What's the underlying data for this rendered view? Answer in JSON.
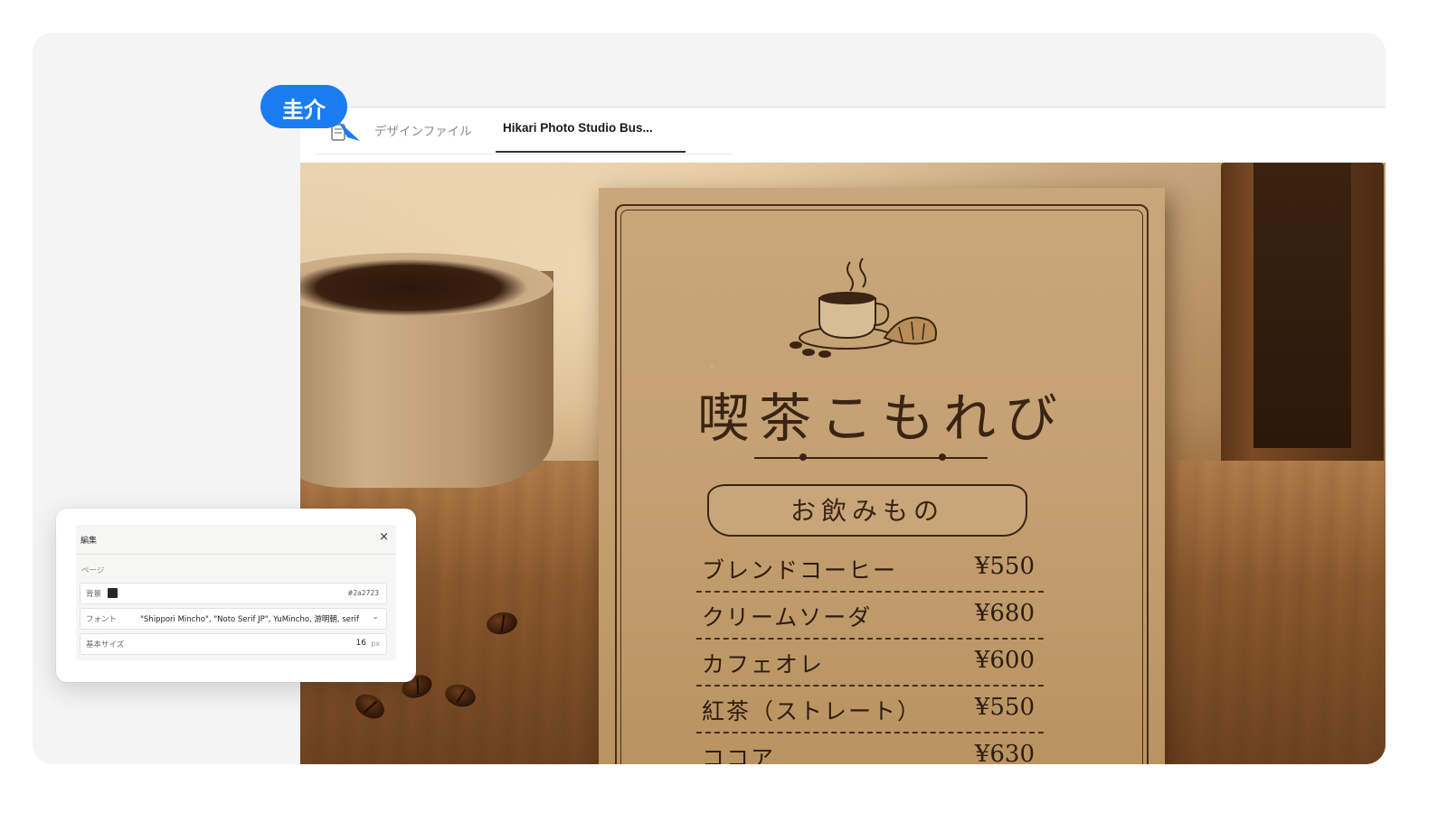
{
  "collaborator": {
    "name": "圭介",
    "color": "#1a7cf0"
  },
  "tabs": [
    {
      "label": "デザインファイル",
      "active": false
    },
    {
      "label": "Hikari Photo Studio Bus...",
      "active": true
    }
  ],
  "menu_card": {
    "title": "喫茶こもれび",
    "section": "お飲みもの",
    "items": [
      {
        "name": "ブレンドコーヒー",
        "price": "¥550"
      },
      {
        "name": "クリームソーダ",
        "price": "¥680"
      },
      {
        "name": "カフェオレ",
        "price": "¥600"
      },
      {
        "name": "紅茶（ストレート）",
        "price": "¥550"
      },
      {
        "name": "ココア",
        "price": "¥630"
      }
    ]
  },
  "edit_panel": {
    "title": "編集",
    "close_icon": "close-icon",
    "section_label": "ページ",
    "background": {
      "label": "背景",
      "color": "#2a2723",
      "value": "#2a2723"
    },
    "font": {
      "label": "フォント",
      "value": "\"Shippori Mincho\", \"Noto Serif JP\", YuMincho, 游明朝, serif"
    },
    "base_size": {
      "label": "基本サイズ",
      "value": "16",
      "unit": "px"
    }
  }
}
